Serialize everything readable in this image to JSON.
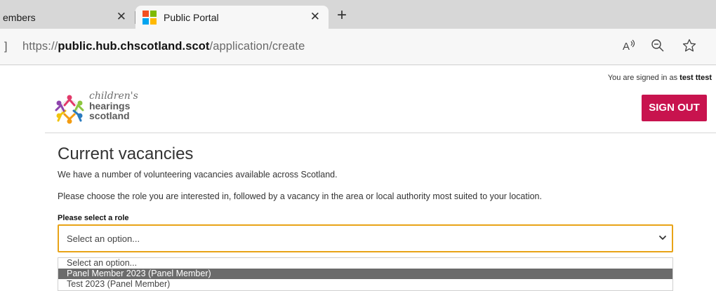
{
  "browser": {
    "tabs": [
      {
        "title": "embers",
        "active": false
      },
      {
        "title": "Public Portal",
        "active": true
      }
    ],
    "new_tab_symbol": "+",
    "close_symbol": "✕",
    "address_prefix": "]",
    "url": {
      "protocol": "https://",
      "host": "public.hub.chscotland.scot",
      "path": "/application/create"
    },
    "icons": [
      "read-aloud-icon",
      "zoom-out-icon",
      "favorite-star-icon"
    ]
  },
  "header": {
    "signed_in_prefix": "You are signed in as",
    "user_name": "test ttest",
    "logo": {
      "line1": "children's",
      "line2": "hearings",
      "line3": "scotland"
    },
    "sign_out_label": "SIGN OUT",
    "brand_color": "#c8134e"
  },
  "main": {
    "title": "Current vacancies",
    "intro": "We have a number of volunteering vacancies available across Scotland.",
    "instructions": "Please choose the role you are interested in, followed by a vacancy in the area or local authority most suited to your location.",
    "role_label": "Please select a role",
    "role_select": {
      "value": "Select an option...",
      "options": [
        {
          "label": "Select an option...",
          "highlighted": false
        },
        {
          "label": "Panel Member 2023 (Panel Member)",
          "highlighted": true
        },
        {
          "label": "Test 2023 (Panel Member)",
          "highlighted": false
        }
      ]
    }
  }
}
